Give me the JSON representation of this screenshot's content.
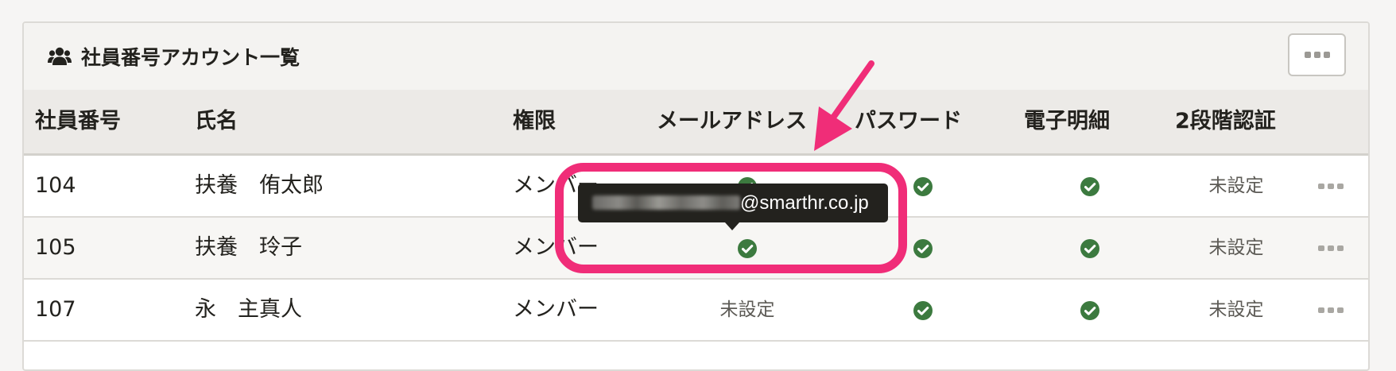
{
  "panel": {
    "title": "社員番号アカウント一覧",
    "title_icon": "users-icon",
    "menu_icon": "more-horizontal-icon"
  },
  "columns": {
    "employee_no": "社員番号",
    "name": "氏名",
    "role": "権限",
    "email": "メールアドレス",
    "password": "パスワード",
    "payslip": "電子明細",
    "two_factor": "2段階認証"
  },
  "rows": [
    {
      "employee_no": "104",
      "name": "扶養　侑太郎",
      "role": "メンバー",
      "email_status": "check",
      "password_status": "check",
      "payslip_status": "check",
      "two_factor": "未設定"
    },
    {
      "employee_no": "105",
      "name": "扶養　玲子",
      "role": "メンバー",
      "email_status": "check",
      "password_status": "check",
      "payslip_status": "check",
      "two_factor": "未設定"
    },
    {
      "employee_no": "107",
      "name": "永　主真人",
      "role": "メンバー",
      "email_status": "未設定",
      "password_status": "check",
      "payslip_status": "check",
      "two_factor": "未設定"
    }
  ],
  "tooltip": {
    "email_domain": "@smarthr.co.jp"
  },
  "colors": {
    "check": "#3c7a3f",
    "highlight": "#f02d78",
    "tooltip_bg": "#23221e"
  }
}
